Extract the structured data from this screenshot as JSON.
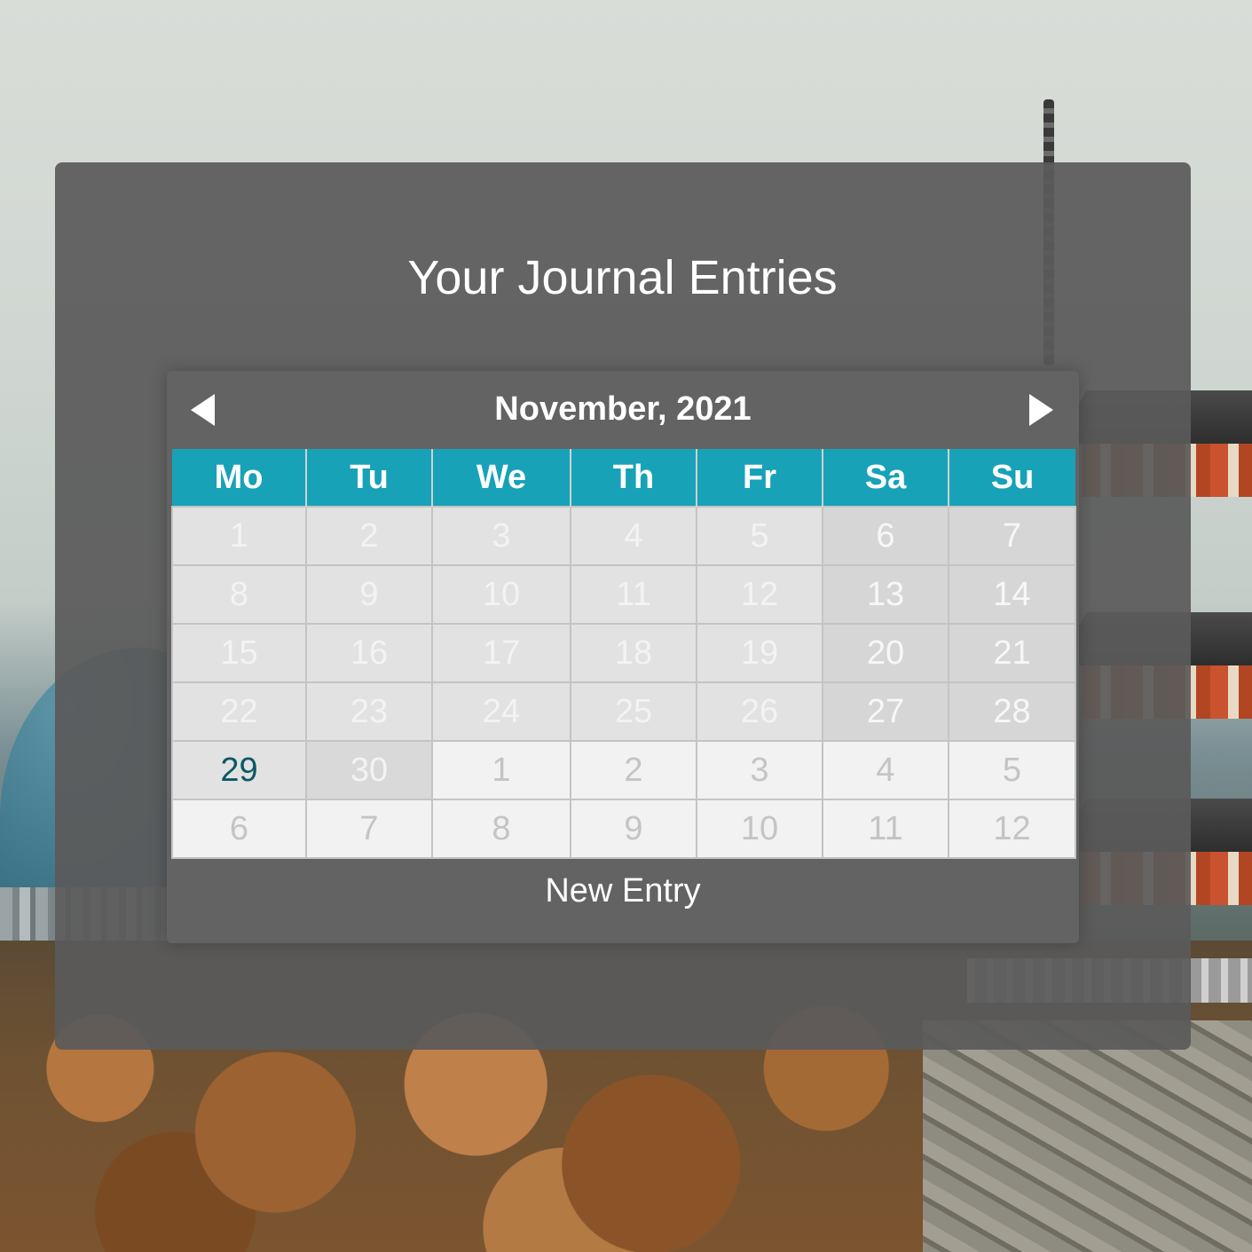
{
  "page": {
    "title": "Your Journal Entries"
  },
  "calendar": {
    "month_label": "November, 2021",
    "prev_icon": "triangle-left-icon",
    "next_icon": "triangle-right-icon",
    "weekdays": [
      "Mo",
      "Tu",
      "We",
      "Th",
      "Fr",
      "Sa",
      "Su"
    ],
    "weeks": [
      [
        {
          "day": "1",
          "type": "in-month"
        },
        {
          "day": "2",
          "type": "in-month"
        },
        {
          "day": "3",
          "type": "in-month"
        },
        {
          "day": "4",
          "type": "in-month"
        },
        {
          "day": "5",
          "type": "in-month"
        },
        {
          "day": "6",
          "type": "in-weekend"
        },
        {
          "day": "7",
          "type": "in-weekend"
        }
      ],
      [
        {
          "day": "8",
          "type": "in-month"
        },
        {
          "day": "9",
          "type": "in-month"
        },
        {
          "day": "10",
          "type": "in-month"
        },
        {
          "day": "11",
          "type": "in-month"
        },
        {
          "day": "12",
          "type": "in-month"
        },
        {
          "day": "13",
          "type": "in-weekend"
        },
        {
          "day": "14",
          "type": "in-weekend"
        }
      ],
      [
        {
          "day": "15",
          "type": "in-month"
        },
        {
          "day": "16",
          "type": "in-month"
        },
        {
          "day": "17",
          "type": "in-month"
        },
        {
          "day": "18",
          "type": "in-month"
        },
        {
          "day": "19",
          "type": "in-month"
        },
        {
          "day": "20",
          "type": "in-weekend"
        },
        {
          "day": "21",
          "type": "in-weekend"
        }
      ],
      [
        {
          "day": "22",
          "type": "in-month"
        },
        {
          "day": "23",
          "type": "in-month"
        },
        {
          "day": "24",
          "type": "in-month"
        },
        {
          "day": "25",
          "type": "in-month"
        },
        {
          "day": "26",
          "type": "in-month"
        },
        {
          "day": "27",
          "type": "in-weekend"
        },
        {
          "day": "28",
          "type": "in-weekend"
        }
      ],
      [
        {
          "day": "29",
          "type": "today"
        },
        {
          "day": "30",
          "type": "in-month-alt"
        },
        {
          "day": "1",
          "type": "other-month"
        },
        {
          "day": "2",
          "type": "other-month"
        },
        {
          "day": "3",
          "type": "other-month"
        },
        {
          "day": "4",
          "type": "other-month"
        },
        {
          "day": "5",
          "type": "other-month"
        }
      ],
      [
        {
          "day": "6",
          "type": "other-month"
        },
        {
          "day": "7",
          "type": "other-month"
        },
        {
          "day": "8",
          "type": "other-month"
        },
        {
          "day": "9",
          "type": "other-month"
        },
        {
          "day": "10",
          "type": "other-month"
        },
        {
          "day": "11",
          "type": "other-month"
        },
        {
          "day": "12",
          "type": "other-month"
        }
      ]
    ],
    "new_entry_label": "New Entry"
  },
  "colors": {
    "header_accent": "#17a2b8",
    "today_text": "#0b5866",
    "panel": "#5a5a5a"
  }
}
